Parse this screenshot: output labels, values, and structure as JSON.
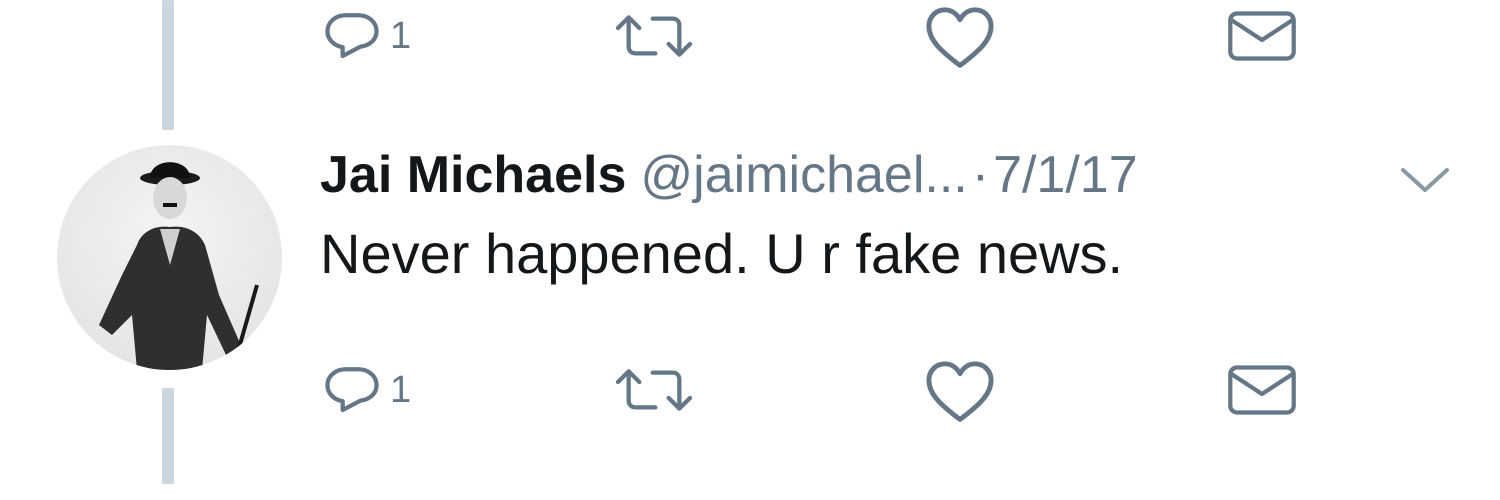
{
  "previous_tweet": {
    "actions": {
      "reply_count": "1"
    }
  },
  "tweet": {
    "author_name": "Jai Michaels",
    "handle": "@jaimichael...",
    "separator": "·",
    "date": "7/1/17",
    "text": "Never happened. U r fake news.",
    "actions": {
      "reply_count": "1"
    }
  },
  "icons": {
    "reply": "reply-icon",
    "retweet": "retweet-icon",
    "like": "heart-icon",
    "dm": "envelope-icon",
    "more": "chevron-down-icon"
  },
  "colors": {
    "icon": "#657786",
    "thread_line": "#cdd6dd",
    "text": "#14171a"
  }
}
